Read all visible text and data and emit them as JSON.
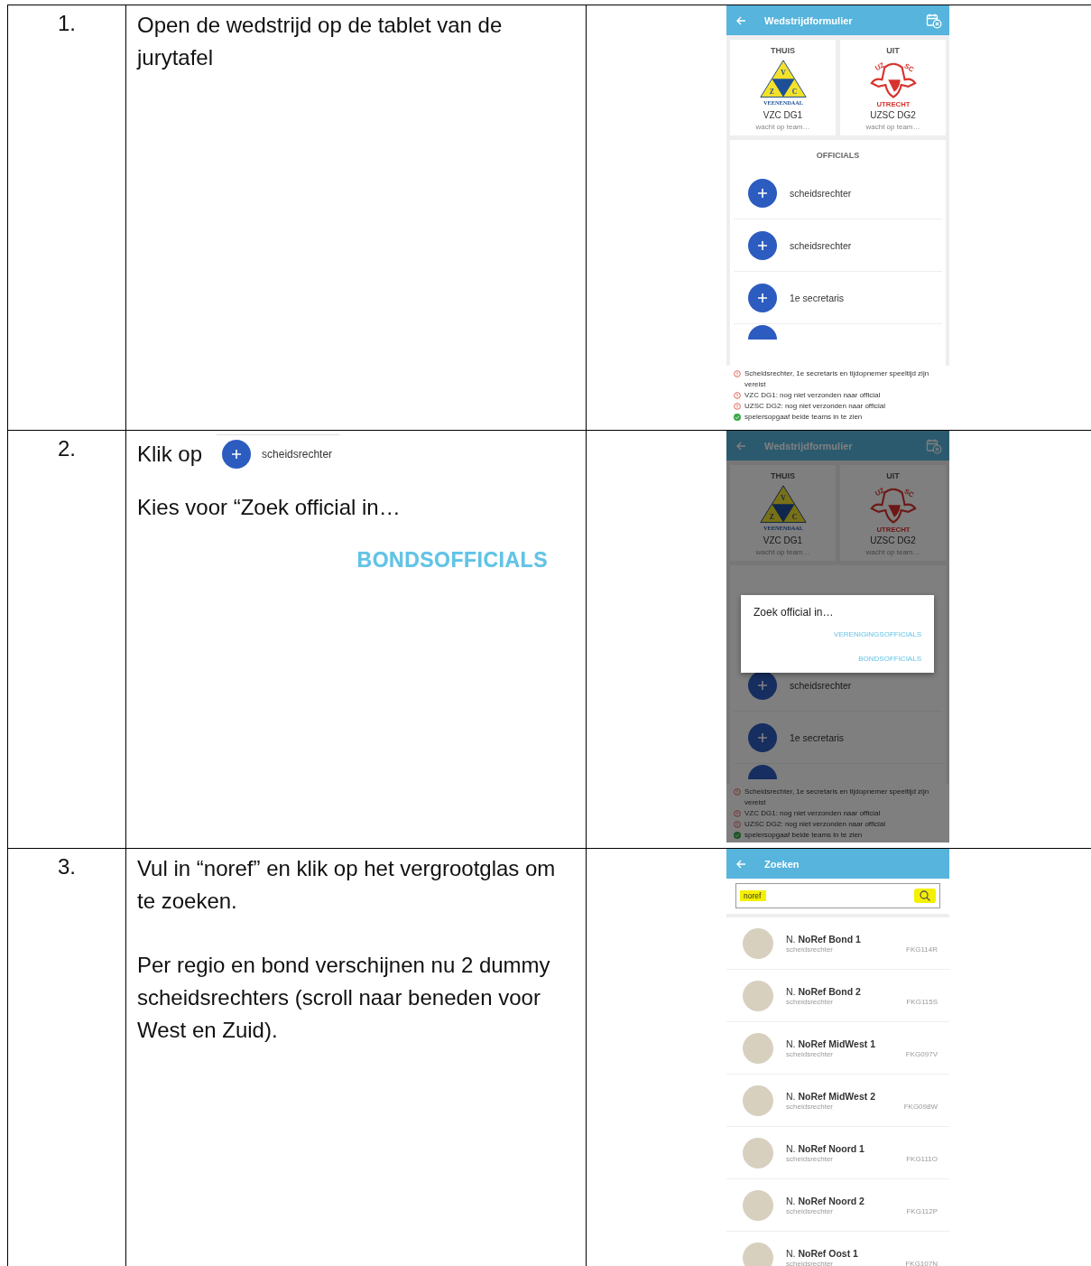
{
  "steps": [
    {
      "number": "1.",
      "content": [
        {
          "kind": "text",
          "text": "Open de wedstrijd op de tablet van de jurytafel"
        }
      ],
      "screen": {
        "kind": "form",
        "title": "Wedstrijdformulier",
        "dimmed": false,
        "home": {
          "label": "THUIS",
          "logo": {
            "kind": "triangle",
            "letters": [
              "V",
              "Z",
              "C"
            ],
            "caption": "VEENENDAAL"
          },
          "team": "VZC DG1",
          "status": "wacht op team…"
        },
        "away": {
          "label": "UIT",
          "logo": {
            "kind": "crest",
            "letters": [
              "UZ",
              "SC"
            ],
            "caption": "UTRECHT"
          },
          "team": "UZSC DG2",
          "status": "wacht op team…"
        },
        "officials_heading": "OFFICIALS",
        "officials": [
          "scheidsrechter",
          "scheidsrechter",
          "1e secretaris"
        ],
        "messages": [
          {
            "text": "Scheidsrechter, 1e secretaris en tijdopnemer speeltijd zijn vereist",
            "ok": false
          },
          {
            "text": "VZC DG1: nog niet verzonden naar official",
            "ok": false
          },
          {
            "text": "UZSC DG2: nog niet verzonden naar official",
            "ok": false
          },
          {
            "text": "spelersopgaaf beide teams in te zien",
            "ok": true
          }
        ]
      }
    },
    {
      "number": "2.",
      "content": [
        {
          "kind": "click",
          "text": "Klik op",
          "button_label": "scheidsrechter"
        },
        {
          "kind": "text",
          "text": "Kies voor “Zoek official in…"
        },
        {
          "kind": "snippet",
          "text": "BONDSOFFICIALS"
        }
      ],
      "screen": {
        "kind": "form",
        "title": "Wedstrijdformulier",
        "dimmed": true,
        "home": {
          "label": "THUIS",
          "logo": {
            "kind": "triangle",
            "letters": [
              "V",
              "Z",
              "C"
            ],
            "caption": "VEENENDAAL"
          },
          "team": "VZC DG1",
          "status": "wacht op team…"
        },
        "away": {
          "label": "UIT",
          "logo": {
            "kind": "crest",
            "letters": [
              "UZ",
              "SC"
            ],
            "caption": "UTRECHT"
          },
          "team": "UZSC DG2",
          "status": "wacht op team…"
        },
        "officials": [
          "scheidsrechter",
          "1e secretaris"
        ],
        "dialog": {
          "title": "Zoek official in…",
          "options": [
            "VERENIGINGSOFFICIALS",
            "BONDSOFFICIALS"
          ]
        },
        "messages": [
          {
            "text": "Scheidsrechter, 1e secretaris en tijdopnemer speeltijd zijn vereist",
            "ok": false
          },
          {
            "text": "VZC DG1: nog niet verzonden naar official",
            "ok": false
          },
          {
            "text": "UZSC DG2: nog niet verzonden naar official",
            "ok": false
          },
          {
            "text": "spelersopgaaf beide teams in te zien",
            "ok": true
          }
        ]
      }
    },
    {
      "number": "3.",
      "content": [
        {
          "kind": "text",
          "text": "Vul in “noref” en klik op het vergrootglas om te zoeken."
        },
        {
          "kind": "text",
          "text": "Per regio en bond verschijnen nu 2 dummy scheidsrechters (scroll naar beneden voor West en Zuid)."
        }
      ],
      "screen": {
        "kind": "search",
        "title": "Zoeken",
        "query": "noref",
        "highlighted": true,
        "results": [
          {
            "name": "N. **NoRef Bond 1**",
            "role": "scheidsrechter",
            "code": "FKG114R"
          },
          {
            "name": "N. **NoRef Bond 2**",
            "role": "scheidsrechter",
            "code": "FKG115S"
          },
          {
            "name": "N. **NoRef MidWest 1**",
            "role": "scheidsrechter",
            "code": "FKG097V"
          },
          {
            "name": "N. **NoRef MidWest 2**",
            "role": "scheidsrechter",
            "code": "FKG098W"
          },
          {
            "name": "N. **NoRef Noord 1**",
            "role": "scheidsrechter",
            "code": "FKG111O"
          },
          {
            "name": "N. **NoRef Noord 2**",
            "role": "scheidsrechter",
            "code": "FKG112P"
          },
          {
            "name": "N. **NoRef Oost 1**",
            "role": "scheidsrechter",
            "code": "FKG107N"
          }
        ]
      }
    }
  ]
}
